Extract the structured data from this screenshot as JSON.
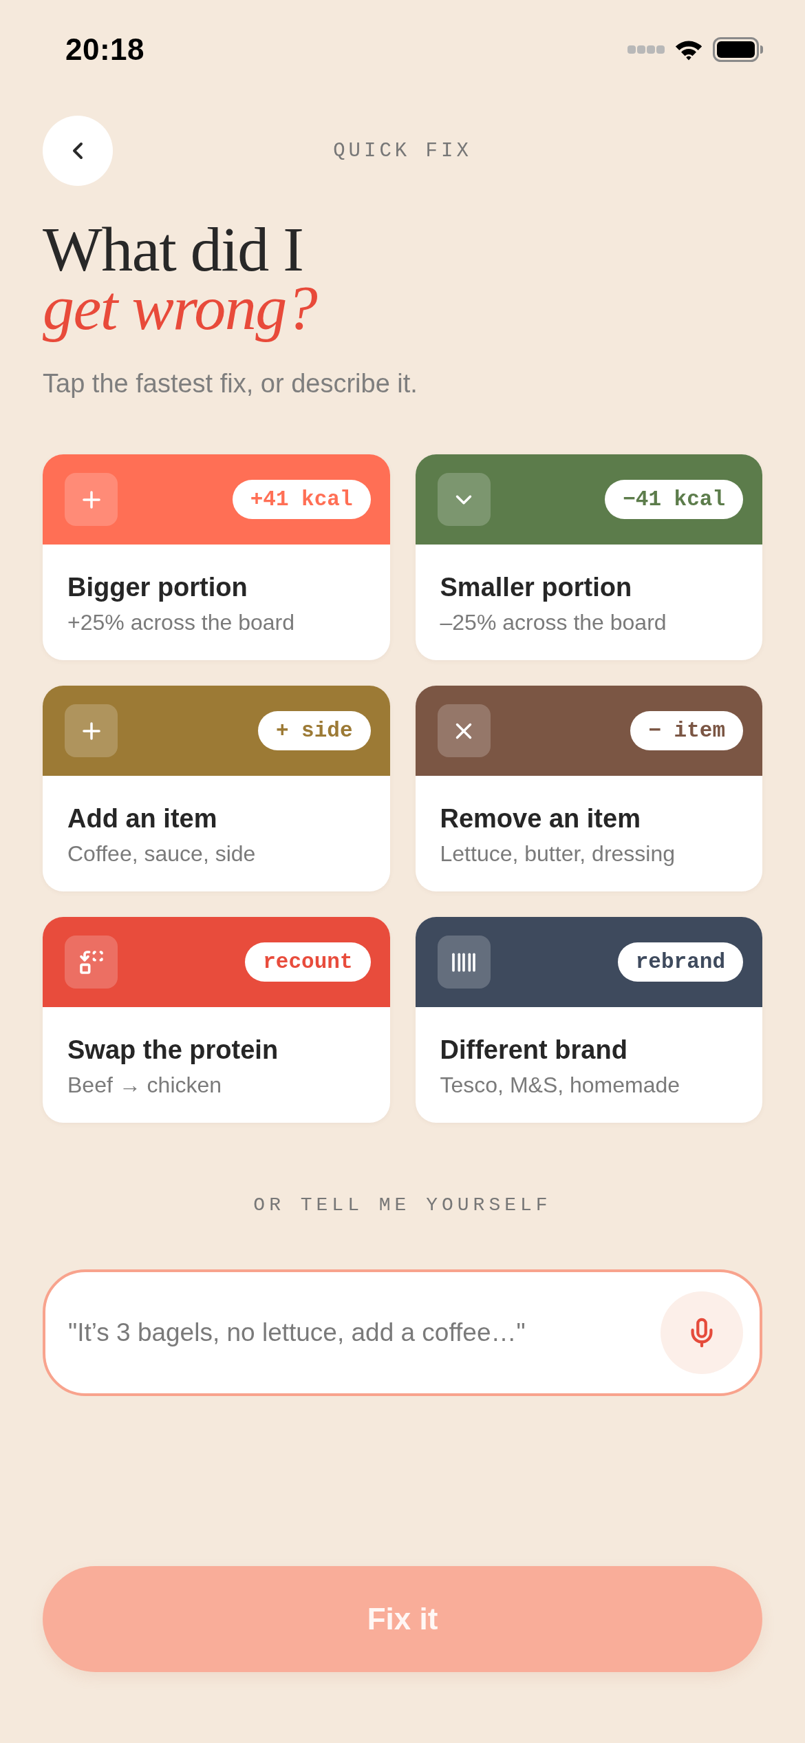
{
  "status_bar": {
    "time": "20:18"
  },
  "header": {
    "title": "QUICK FIX"
  },
  "headline": {
    "line_1": "What did I",
    "line_2": "get wrong?"
  },
  "subtitle": "Tap the fastest fix, or describe it.",
  "options": [
    {
      "kind": "increase",
      "color": "#ff6f55",
      "badge": "+41 kcal",
      "title": "Bigger portion",
      "subtitle": "+25% across the board",
      "selected": false
    },
    {
      "kind": "decrease",
      "color": "#5c7c4b",
      "badge": "−41 kcal",
      "title": "Smaller portion",
      "subtitle": "–25% across the board",
      "selected": false
    },
    {
      "kind": "add",
      "color": "#9c7a35",
      "badge": "+ side",
      "title": "Add an item",
      "subtitle": "Coffee, sauce, side",
      "selected": false
    },
    {
      "kind": "remove",
      "color": "#7b5644",
      "badge": "− item",
      "title": "Remove an item",
      "subtitle": "Lettuce, butter, dressing",
      "selected": false
    },
    {
      "kind": "swap",
      "color": "#e84c3c",
      "badge": "recount",
      "title": "Swap the protein",
      "subtitle": "Beef → chicken",
      "selected": false
    },
    {
      "kind": "brand",
      "color": "#3e4a5d",
      "badge": "rebrand",
      "title": "Different brand",
      "subtitle": "Tesco, M&S, homemade",
      "selected": false
    }
  ],
  "divider_label": "OR TELL ME YOURSELF",
  "input": {
    "placeholder": "\"It’s 3 bagels, no lettuce, add a coffee…\""
  },
  "fix_button": {
    "label": "Fix it",
    "disabled": true
  }
}
